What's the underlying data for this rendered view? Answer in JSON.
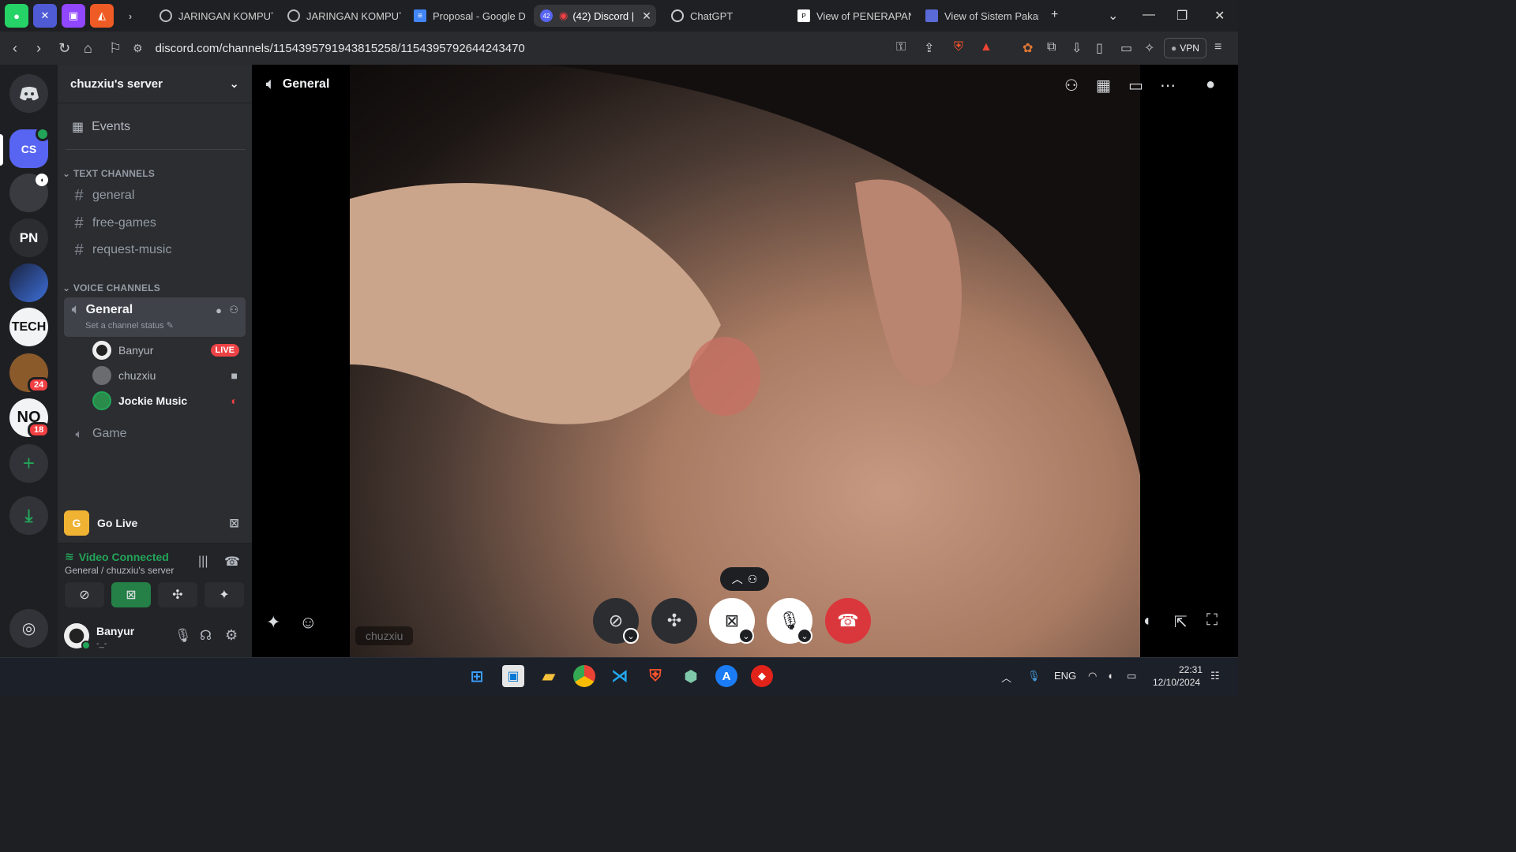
{
  "browser": {
    "pinned": [
      "WhatsApp",
      "Teams",
      "Twitch",
      "Postman"
    ],
    "tabs": [
      {
        "label": "JARINGAN KOMPUT",
        "icon": "globe-icon"
      },
      {
        "label": "JARINGAN KOMPUT",
        "icon": "globe-icon"
      },
      {
        "label": "Proposal - Google D",
        "icon": "docs-icon"
      },
      {
        "label": "(42) Discord |",
        "icon": "discord-icon",
        "active": true
      },
      {
        "label": "ChatGPT",
        "icon": "chatgpt-icon"
      },
      {
        "label": "View of PENERAPAN",
        "icon": "pkn-icon"
      },
      {
        "label": "View of Sistem Pakar",
        "icon": "journal-icon"
      }
    ],
    "tab_badge": "42",
    "url": "discord.com/channels/1154395791943815258/1154395792644243470",
    "vpn_label": "VPN"
  },
  "rail": {
    "servers": [
      {
        "label": "CS",
        "color": "#5865f2"
      },
      {
        "label": "",
        "color": "#3a3b40"
      },
      {
        "label": "PN",
        "color": "#2b2d31"
      },
      {
        "label": "",
        "color": "#3d5fb8"
      },
      {
        "label": "TECH",
        "color": "#f2f3f5"
      },
      {
        "label": "",
        "color": "#8b5a2b",
        "badge": "24"
      },
      {
        "label": "NO",
        "color": "#f2f3f5",
        "badge": "18"
      }
    ]
  },
  "sidebar": {
    "server_name": "chuzxiu's server",
    "events_label": "Events",
    "text_category": "TEXT CHANNELS",
    "text_channels": [
      "general",
      "free-games",
      "request-music"
    ],
    "voice_category": "VOICE CHANNELS",
    "voice_active": {
      "name": "General",
      "status": "Set a channel status"
    },
    "members": [
      {
        "name": "Banyur",
        "tag": "LIVE"
      },
      {
        "name": "chuzxiu",
        "tag": ""
      },
      {
        "name": "Jockie Music",
        "tag": ""
      }
    ],
    "voice_other": "Game"
  },
  "panel": {
    "golive_label": "Go Live",
    "vc_status": "Video Connected",
    "vc_location": "General / chuzxiu's server",
    "user_name": "Banyur",
    "user_status": "-_-"
  },
  "stage": {
    "channel_name": "General",
    "participant_name": "chuzxiu"
  },
  "taskbar": {
    "lang": "ENG",
    "time": "22:31",
    "date": "12/10/2024"
  }
}
